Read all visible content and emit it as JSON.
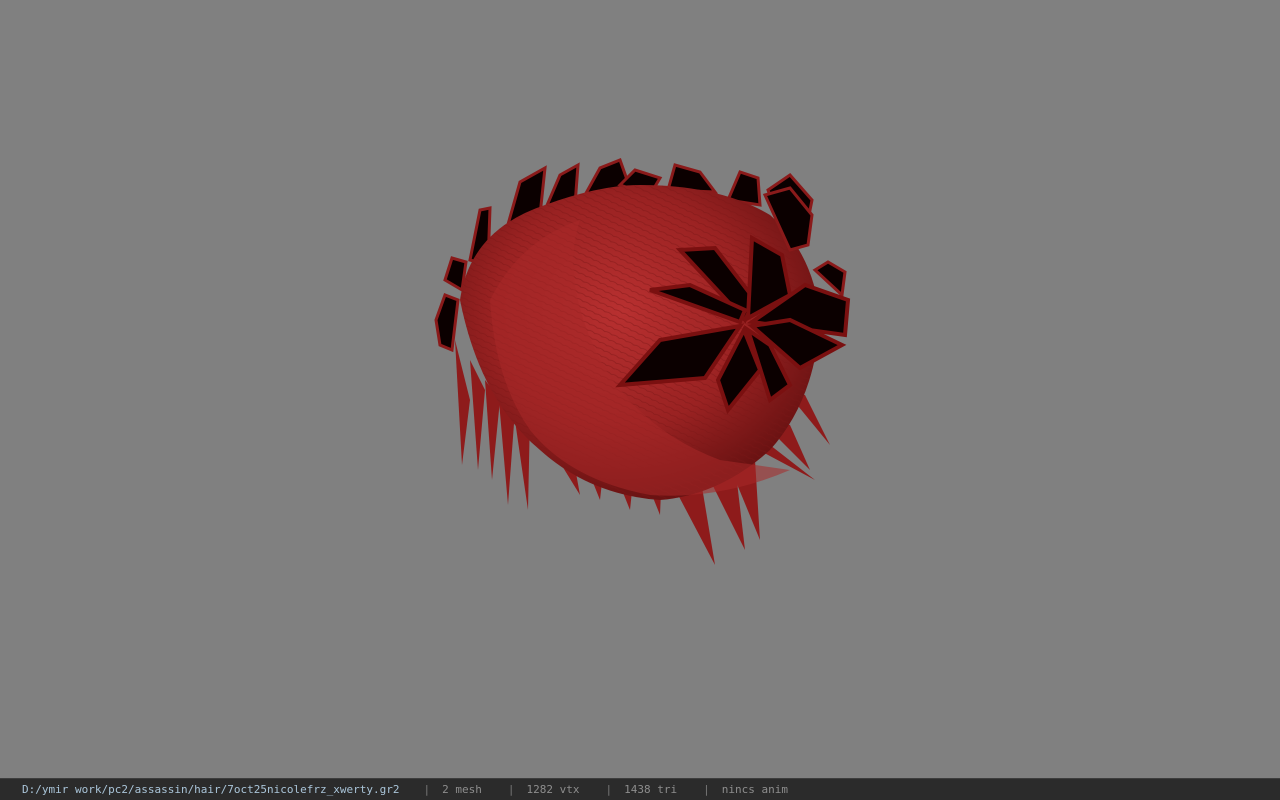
{
  "status_bar": {
    "file_path": "D:/ymir work/pc2/assassin/hair/7oct25nicolefrz_xwerty.gr2",
    "separator": "|",
    "mesh_count": "2 mesh",
    "vertex_count": "1282 vtx",
    "triangle_count": "1438 tri",
    "anim": "nincs anim"
  },
  "colors": {
    "viewport_bg": "#808080",
    "hair_red": "#a52525",
    "hair_dark": "#6e1010",
    "leaf_black": "#0b0000",
    "status_bg": "#2b2b2b",
    "path_text": "#a9c4d8"
  }
}
